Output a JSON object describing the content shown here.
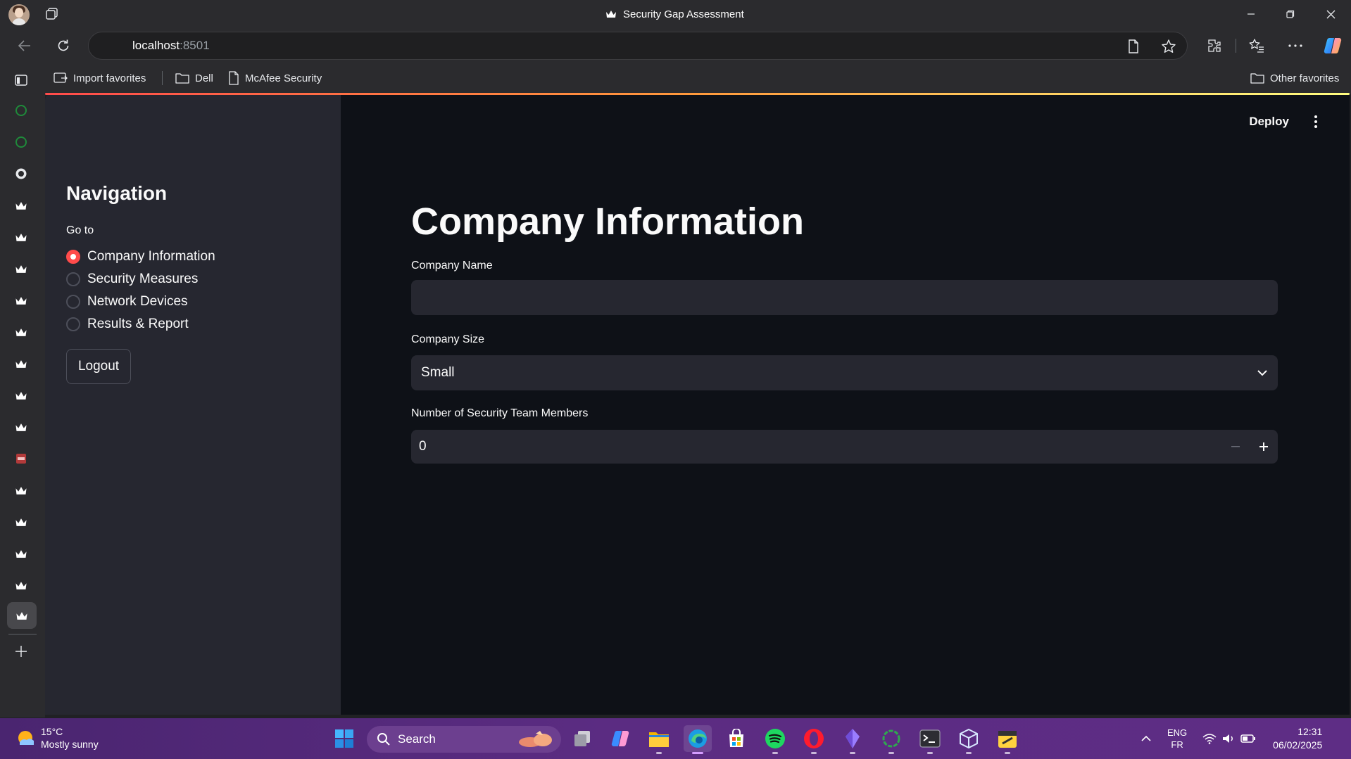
{
  "browser": {
    "tab_title": "Security Gap Assessment",
    "url_host": "localhost",
    "url_port": ":8501",
    "favorites": [
      {
        "label": "Import favorites"
      },
      {
        "label": "Dell"
      },
      {
        "label": "McAfee Security"
      }
    ],
    "other_favorites": "Other favorites"
  },
  "app": {
    "deploy_label": "Deploy",
    "sidebar": {
      "title": "Navigation",
      "goto_label": "Go to",
      "options": [
        {
          "label": "Company Information",
          "selected": true
        },
        {
          "label": "Security Measures",
          "selected": false
        },
        {
          "label": "Network Devices",
          "selected": false
        },
        {
          "label": "Results & Report",
          "selected": false
        }
      ],
      "logout_label": "Logout"
    },
    "main": {
      "title": "Company Information",
      "company_name": {
        "label": "Company Name",
        "value": ""
      },
      "company_size": {
        "label": "Company Size",
        "value": "Small"
      },
      "security_team": {
        "label": "Number of Security Team Members",
        "value": "0"
      }
    },
    "accent_color": "#ff4b4b"
  },
  "taskbar": {
    "weather_temp": "15°C",
    "weather_desc": "Mostly sunny",
    "search_label": "Search",
    "lang_primary": "ENG",
    "lang_secondary": "FR",
    "time": "12:31",
    "date": "06/02/2025"
  }
}
